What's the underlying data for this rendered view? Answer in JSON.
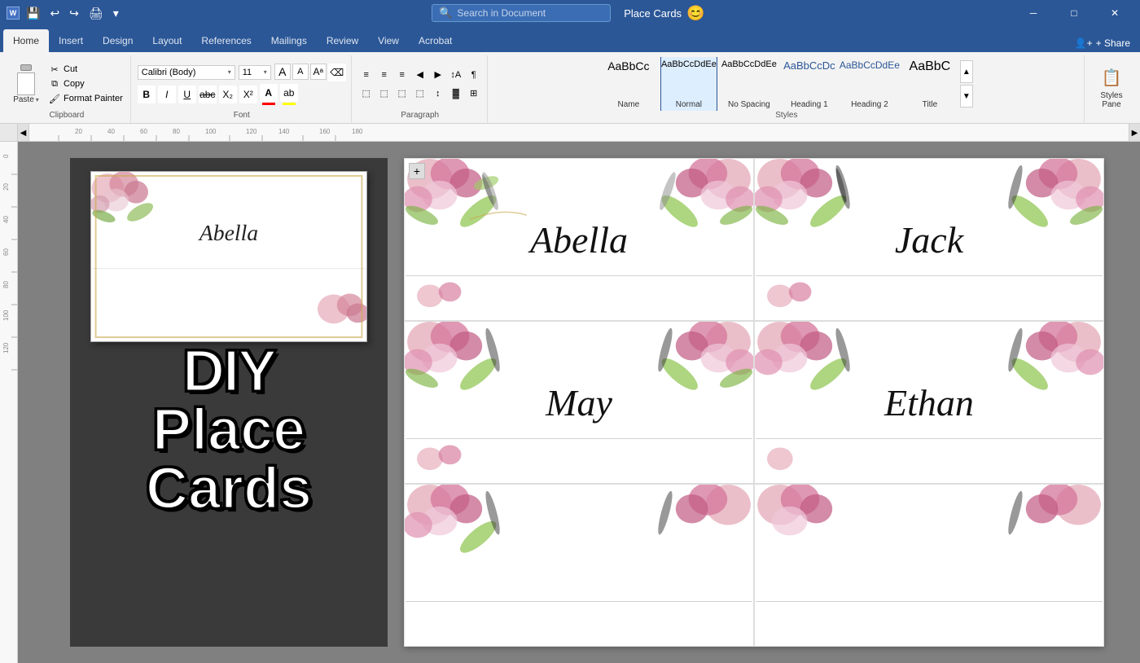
{
  "titleBar": {
    "title": "Place Cards",
    "docIcon": "W",
    "windowControls": [
      "─",
      "□",
      "✕"
    ],
    "quickAccess": {
      "icons": [
        "□",
        "↩",
        "↪",
        "💾",
        "🖨",
        "✏",
        "▾"
      ]
    },
    "searchPlaceholder": "Search in Document"
  },
  "ribbon": {
    "tabs": [
      "Home",
      "Insert",
      "Design",
      "Layout",
      "References",
      "Mailings",
      "Review",
      "View",
      "Acrobat"
    ],
    "activeTab": "Home",
    "shareLabel": "+ Share",
    "clipboard": {
      "groupLabel": "Clipboard",
      "pasteLabel": "Paste",
      "cutLabel": "Cut",
      "copyLabel": "Copy",
      "formatPainterLabel": "Format Painter"
    },
    "font": {
      "groupLabel": "Font",
      "fontName": "Calibri (Body)",
      "fontSize": "11",
      "boldLabel": "B",
      "italicLabel": "I",
      "underlineLabel": "U",
      "strikethroughLabel": "abc",
      "subscriptLabel": "X₂",
      "superscriptLabel": "X²",
      "changeCaseLabel": "Aa",
      "clearFormattingLabel": "A",
      "fontColorLabel": "A",
      "highlightLabel": "ab",
      "fontColorBar": "#FF0000",
      "highlightBar": "#FFFF00"
    },
    "paragraph": {
      "groupLabel": "Paragraph",
      "bullets": "≡",
      "numbering": "≡",
      "multiList": "≡",
      "decreaseIndent": "←",
      "increaseIndent": "→",
      "sort": "↕",
      "showHide": "¶",
      "alignLeft": "≡",
      "alignCenter": "≡",
      "alignRight": "≡",
      "justify": "≡",
      "lineSpacing": "↕",
      "shading": "▓",
      "borders": "⊞"
    },
    "styles": {
      "groupLabel": "Styles",
      "items": [
        {
          "preview": "AaBbCc",
          "label": "Name",
          "active": false
        },
        {
          "preview": "AaBbCcDdEe",
          "label": "Normal",
          "active": true
        },
        {
          "preview": "AaBbCcDdEe",
          "label": "No Spacing",
          "active": false
        },
        {
          "preview": "AaBbCcDc",
          "label": "Heading 1",
          "active": false
        },
        {
          "preview": "AaBbCcDdEe",
          "label": "Heading 2",
          "active": false
        },
        {
          "preview": "AaBbC",
          "label": "Title",
          "active": false
        }
      ]
    },
    "stylesPane": {
      "label": "Styles\nPane"
    }
  },
  "ruler": {
    "marks": [
      0,
      20,
      40,
      60,
      80,
      100,
      120,
      140,
      160,
      180
    ]
  },
  "thumbnail": {
    "name": "Abella"
  },
  "diy": {
    "line1": "DIY",
    "line2": "Place Cards"
  },
  "placards": [
    {
      "name": "Abella",
      "position": "top-left"
    },
    {
      "name": "Jack",
      "position": "top-right"
    },
    {
      "name": "May",
      "position": "mid-left"
    },
    {
      "name": "Ethan",
      "position": "mid-right"
    },
    {
      "name": "",
      "position": "bot-left"
    },
    {
      "name": "",
      "position": "bot-right"
    }
  ]
}
